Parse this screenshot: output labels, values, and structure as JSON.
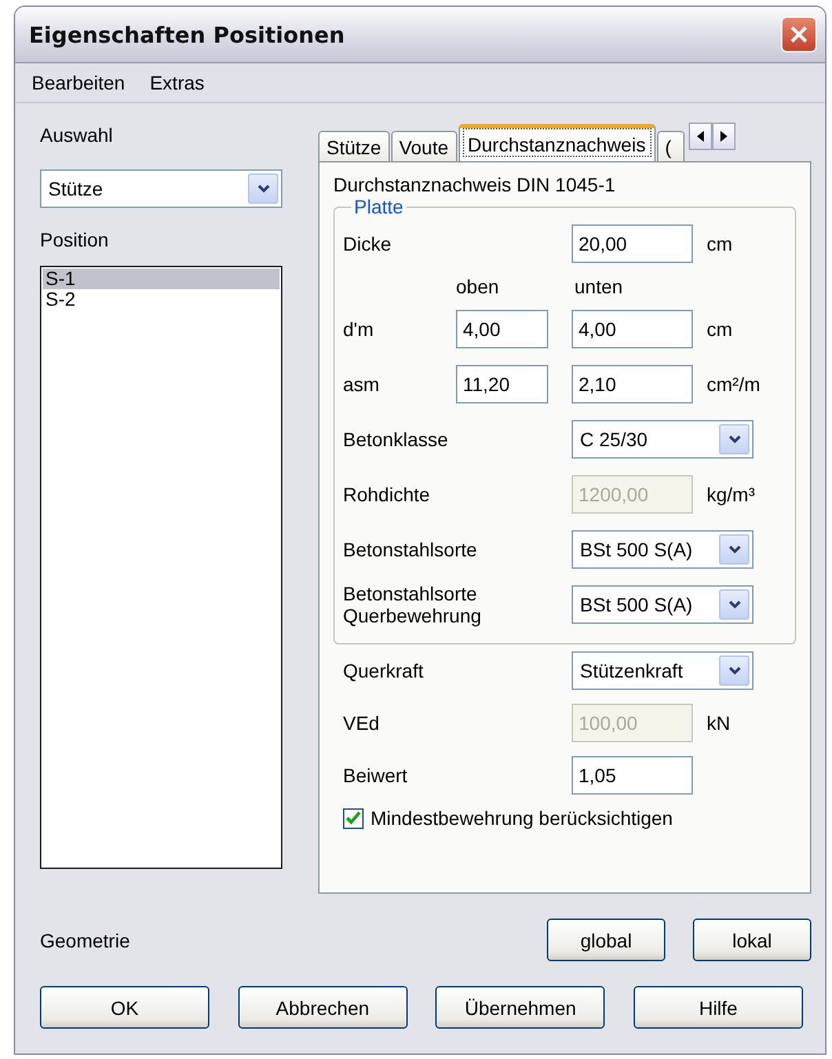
{
  "window": {
    "title": "Eigenschaften Positionen"
  },
  "menu": [
    {
      "label": "Bearbeiten"
    },
    {
      "label": "Extras"
    }
  ],
  "left": {
    "selection_label": "Auswahl",
    "selection_value": "Stütze",
    "position_label": "Position",
    "positions": [
      {
        "label": "S-1",
        "selected": true
      },
      {
        "label": "S-2",
        "selected": false
      }
    ]
  },
  "tabs": [
    {
      "label": "Stütze",
      "selected": false
    },
    {
      "label": "Voute",
      "selected": false
    },
    {
      "label": "Durchstanznachweis",
      "selected": true
    },
    {
      "label": "(",
      "selected": false
    }
  ],
  "panel": {
    "heading": "Durchstanznachweis DIN 1045-1",
    "group": {
      "title": "Platte",
      "rows": [
        {
          "kind": "field",
          "label": "Dicke",
          "value": "20,00",
          "unit": "cm",
          "disabled": false
        },
        {
          "kind": "headers",
          "columns": [
            "oben",
            "unten"
          ]
        },
        {
          "kind": "pair",
          "label": "d'm",
          "values": [
            "4,00",
            "4,00"
          ],
          "unit": "cm"
        },
        {
          "kind": "pair",
          "label": "asm",
          "values": [
            "11,20",
            "2,10"
          ],
          "unit": "cm²/m"
        },
        {
          "kind": "combo",
          "label": "Betonklasse",
          "value": "C 25/30"
        },
        {
          "kind": "field",
          "label": "Rohdichte",
          "value": "1200,00",
          "unit": "kg/m³",
          "disabled": true
        },
        {
          "kind": "combo",
          "label": "Betonstahlsorte",
          "value": "BSt 500 S(A)"
        },
        {
          "kind": "combo",
          "label": "Betonstahlsorte Querbewehrung",
          "value": "BSt 500 S(A)"
        }
      ]
    },
    "rows": [
      {
        "kind": "combo",
        "label": "Querkraft",
        "value": "Stützenkraft"
      },
      {
        "kind": "field",
        "label": "VEd",
        "value": "100,00",
        "unit": "kN",
        "disabled": true
      },
      {
        "kind": "field",
        "label": "Beiwert",
        "value": "1,05",
        "disabled": false
      }
    ],
    "checkbox": {
      "label": "Mindestbewehrung berücksichtigen",
      "checked": true
    }
  },
  "geometry": {
    "label": "Geometrie",
    "buttons": [
      "global",
      "lokal"
    ]
  },
  "buttons": [
    "OK",
    "Abbrechen",
    "Übernehmen",
    "Hilfe"
  ]
}
